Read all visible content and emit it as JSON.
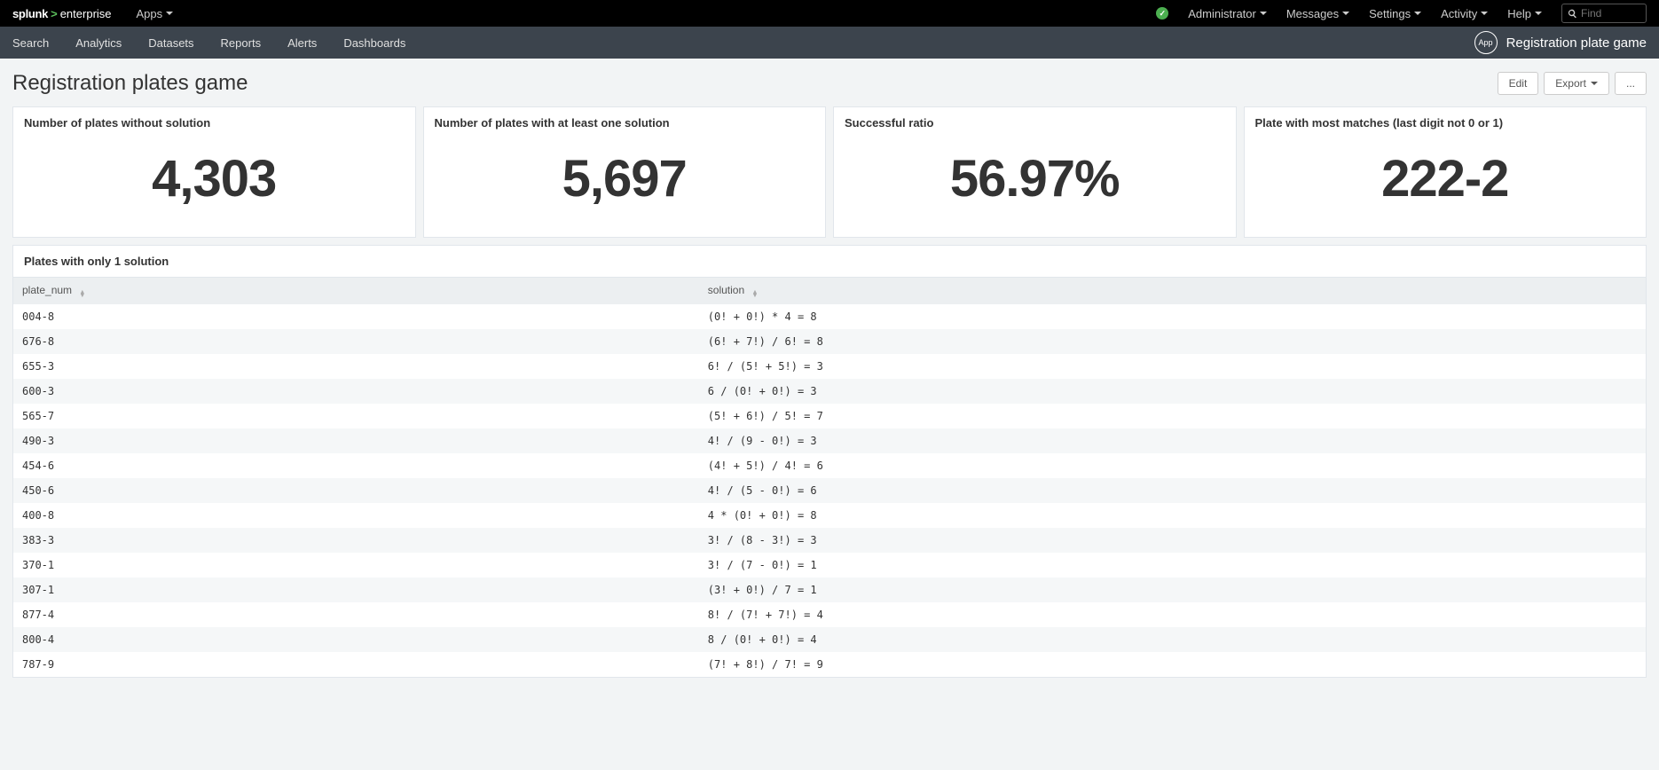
{
  "topbar": {
    "logo_splunk": "splunk",
    "logo_ent": "enterprise",
    "apps": "Apps",
    "admin": "Administrator",
    "messages": "Messages",
    "settings": "Settings",
    "activity": "Activity",
    "help": "Help",
    "find_placeholder": "Find"
  },
  "nav": {
    "items": [
      "Search",
      "Analytics",
      "Datasets",
      "Reports",
      "Alerts",
      "Dashboards"
    ],
    "app_badge": "App",
    "app_name": "Registration plate game"
  },
  "page": {
    "title": "Registration plates game",
    "edit": "Edit",
    "export": "Export",
    "more": "..."
  },
  "panels": [
    {
      "title": "Number of plates without solution",
      "value": "4,303"
    },
    {
      "title": "Number of plates with at least one solution",
      "value": "5,697"
    },
    {
      "title": "Successful ratio",
      "value": "56.97%"
    },
    {
      "title": "Plate with most matches (last digit not 0 or 1)",
      "value": "222-2"
    }
  ],
  "table": {
    "title": "Plates with only 1 solution",
    "col1": "plate_num",
    "col2": "solution",
    "rows": [
      {
        "plate": "004-8",
        "sol": "(0! + 0!) * 4 = 8"
      },
      {
        "plate": "676-8",
        "sol": "(6! + 7!) / 6! = 8"
      },
      {
        "plate": "655-3",
        "sol": "6! / (5! + 5!) = 3"
      },
      {
        "plate": "600-3",
        "sol": "6 / (0! + 0!) = 3"
      },
      {
        "plate": "565-7",
        "sol": "(5! + 6!) / 5! = 7"
      },
      {
        "plate": "490-3",
        "sol": "4! / (9 - 0!) = 3"
      },
      {
        "plate": "454-6",
        "sol": "(4! + 5!) / 4! = 6"
      },
      {
        "plate": "450-6",
        "sol": "4! / (5 - 0!) = 6"
      },
      {
        "plate": "400-8",
        "sol": "4 * (0! + 0!) = 8"
      },
      {
        "plate": "383-3",
        "sol": "3! / (8 - 3!) = 3"
      },
      {
        "plate": "370-1",
        "sol": "3! / (7 - 0!) = 1"
      },
      {
        "plate": "307-1",
        "sol": "(3! + 0!) / 7 = 1"
      },
      {
        "plate": "877-4",
        "sol": "8! / (7! + 7!) = 4"
      },
      {
        "plate": "800-4",
        "sol": "8 / (0! + 0!) = 4"
      },
      {
        "plate": "787-9",
        "sol": "(7! + 8!) / 7! = 9"
      }
    ]
  }
}
